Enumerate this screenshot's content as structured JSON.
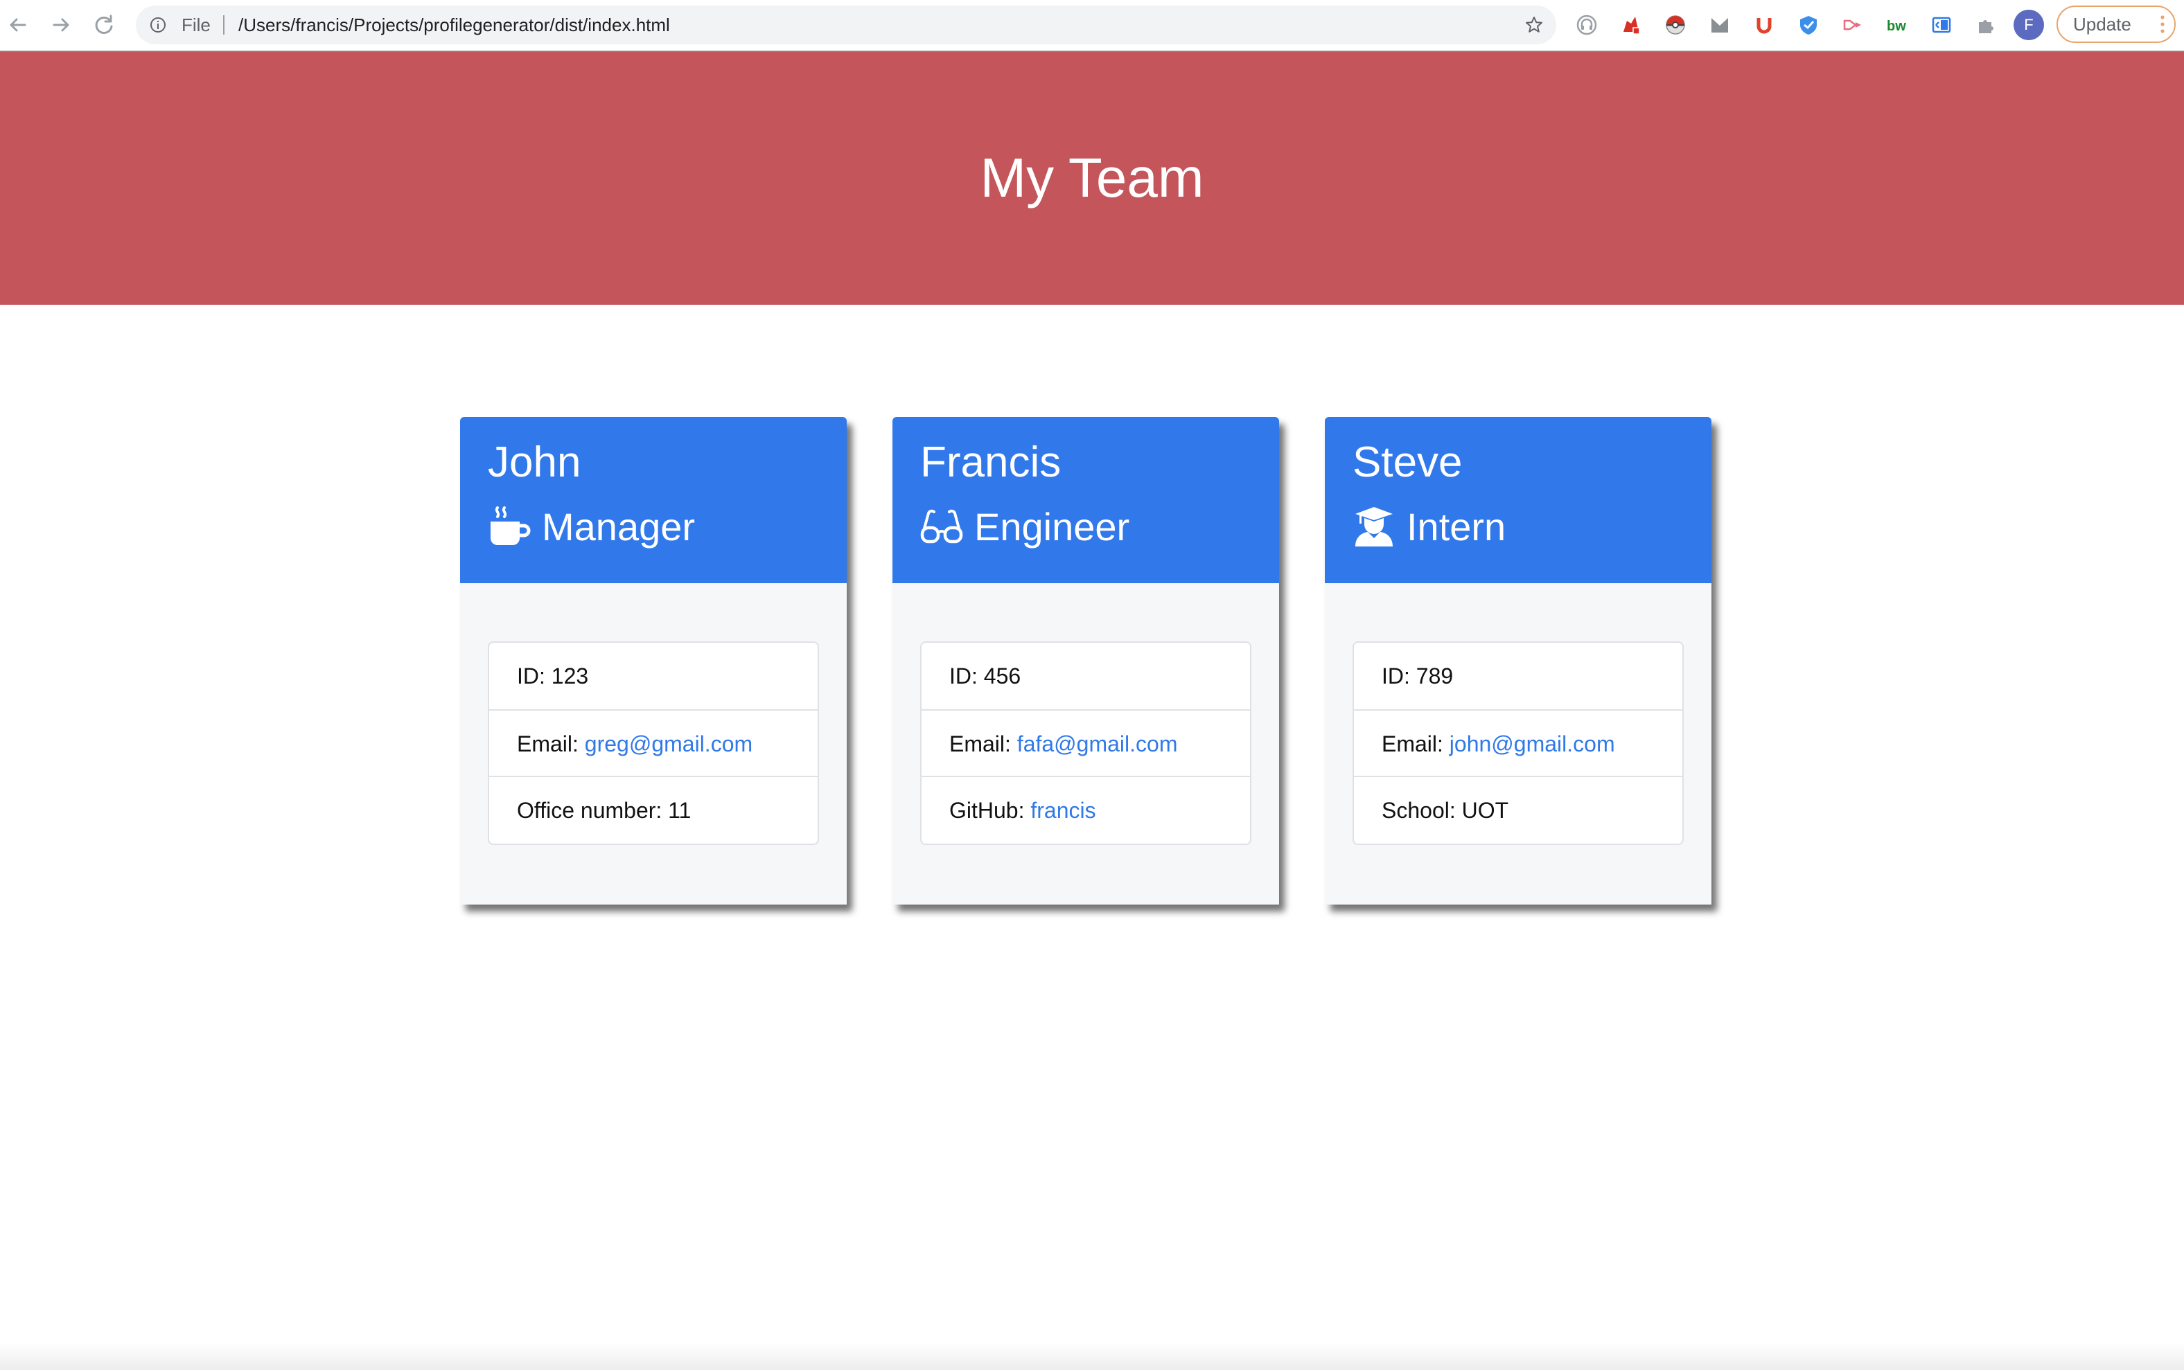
{
  "browser": {
    "address_scheme": "File",
    "address_url": "/Users/francis/Projects/profilegenerator/dist/index.html",
    "profile_initial": "F",
    "update_label": "Update",
    "extension_icons": [
      "headphones-icon",
      "red-extension-icon",
      "pokeball-icon",
      "m-extension-icon",
      "u-extension-icon",
      "shield-extension-icon",
      "vimeo-like-icon",
      "bw-extension-icon",
      "screen-reader-icon",
      "puzzle-icon"
    ]
  },
  "page": {
    "title": "My Team",
    "header_color": "#c4565b",
    "card_header_color": "#3179ea",
    "link_color": "#2f79e8"
  },
  "team": [
    {
      "name": "John",
      "role": "Manager",
      "role_icon": "coffee-mug-icon",
      "id_label": "ID: 123",
      "email_prefix": "Email: ",
      "email": "greg@gmail.com",
      "extra_prefix": "Office number: 11",
      "extra_link": ""
    },
    {
      "name": "Francis",
      "role": "Engineer",
      "role_icon": "glasses-icon",
      "id_label": "ID: 456",
      "email_prefix": "Email: ",
      "email": "fafa@gmail.com",
      "extra_prefix": "GitHub: ",
      "extra_link": "francis"
    },
    {
      "name": "Steve",
      "role": "Intern",
      "role_icon": "graduate-icon",
      "id_label": "ID: 789",
      "email_prefix": "Email: ",
      "email": "john@gmail.com",
      "extra_prefix": "School: UOT",
      "extra_link": ""
    }
  ]
}
